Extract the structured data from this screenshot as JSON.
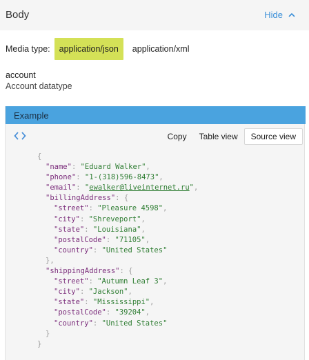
{
  "body_section": {
    "title": "Body",
    "toggle_label": "Hide",
    "toggle_icon": "chevron-up-icon"
  },
  "media": {
    "label": "Media type:",
    "options": [
      "application/json",
      "application/xml"
    ],
    "selected": "application/json"
  },
  "datatype": {
    "name": "account",
    "description": "Account datatype"
  },
  "example": {
    "title": "Example",
    "view_toggle_icon": "code-brackets-icon",
    "buttons": {
      "copy": "Copy",
      "table_view": "Table view",
      "source_view": "Source view"
    },
    "active_view": "Source view"
  },
  "json_source": {
    "name": "Eduard Walker",
    "phone": "1-(318)596-8473",
    "email": "ewalker@liveinternet.ru",
    "billingAddress": {
      "street": "Pleasure 4598",
      "city": "Shreveport",
      "state": "Louisiana",
      "postalCode": "71105",
      "country": "United States"
    },
    "shippingAddress": {
      "street": "Autumn Leaf 3",
      "city": "Jackson",
      "state": "Mississippi",
      "postalCode": "39204",
      "country": "United States"
    }
  },
  "colors": {
    "accent": "#4aa3df",
    "link": "#3a8fd8",
    "selected_media": "#d4e157",
    "json_key": "#7b2d7b",
    "json_string": "#2e7d32"
  }
}
